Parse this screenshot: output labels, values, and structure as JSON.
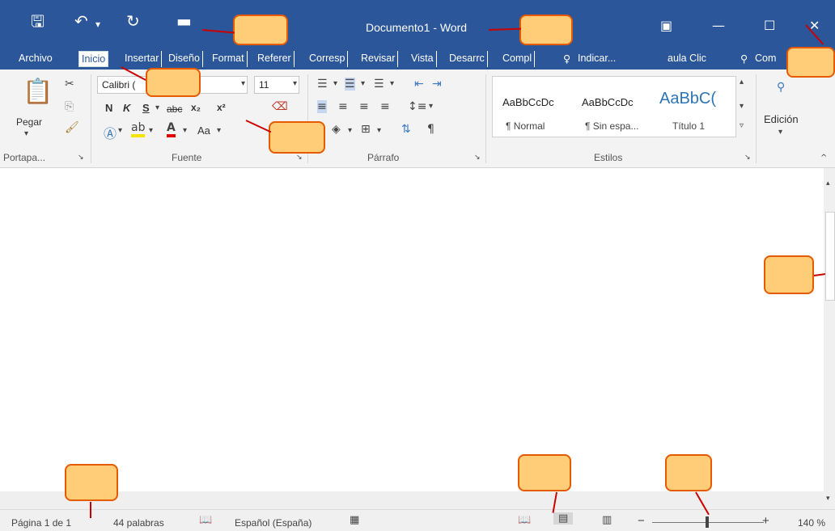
{
  "titlebar": {
    "title": "Documento1 - Word",
    "icons": [
      "save-icon",
      "undo-icon",
      "redo-icon",
      "open-folder-icon",
      "ribbon-display-icon",
      "minimize-icon",
      "maximize-icon",
      "close-icon"
    ]
  },
  "tabs": [
    "Archivo",
    "Inicio",
    "Insertar",
    "Diseño",
    "Format",
    "Referer",
    "Corresp",
    "Revisar",
    "Vista",
    "Desarrc",
    "Compl",
    "Indicar...",
    "aula Clic",
    "Com"
  ],
  "ribbon": {
    "paste_label": "Pegar",
    "font_name": "Calibri (",
    "font_size": "11",
    "format_buttons": [
      "N",
      "K",
      "S",
      "abc",
      "x₂",
      "x²"
    ],
    "case_button": "Aa",
    "styles": [
      {
        "sample": "AaBbCcDc",
        "name": "¶ Normal"
      },
      {
        "sample": "AaBbCcDc",
        "name": "¶ Sin espa..."
      },
      {
        "sample": "AaBbC(",
        "name": "Título 1"
      }
    ],
    "editing_label": "Edición",
    "groups": [
      "Portapa...",
      "Fuente",
      "Párrafo",
      "Estilos"
    ]
  },
  "status": {
    "page": "Página 1 de 1",
    "words": "44 palabras",
    "language": "Español (España)",
    "zoom": "140 %",
    "zoom_percent": 140
  },
  "colors": {
    "title_bar": "#2b579a",
    "callout_border": "#e65a00",
    "callout_fill": "#ffcc77",
    "arrow": "#cc0000"
  }
}
